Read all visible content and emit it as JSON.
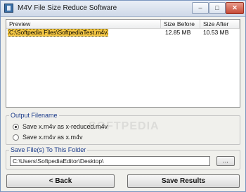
{
  "window": {
    "title": "M4V File Size Reduce Software",
    "minimize": "–",
    "maximize": "□",
    "close": "✕"
  },
  "list": {
    "headers": {
      "preview": "Preview",
      "size_before": "Size Before",
      "size_after": "Size After"
    },
    "rows": [
      {
        "file": "C:\\Softpedia Files\\SoftpediaTest.m4v",
        "size_before": "12.85 MB",
        "size_after": "10.53 MB"
      }
    ]
  },
  "output_filename": {
    "title": "Output Filename",
    "options": [
      {
        "label": "Save x.m4v as x-reduced.m4v",
        "selected": true
      },
      {
        "label": "Save x.m4v as x.m4v",
        "selected": false
      }
    ]
  },
  "save_folder": {
    "title": "Save File(s) To This Folder",
    "path": "C:\\Users\\SoftpediaEditor\\Desktop\\",
    "browse_label": "..."
  },
  "buttons": {
    "back": "< Back",
    "save": "Save Results"
  },
  "watermark": "SOFTPEDIA"
}
